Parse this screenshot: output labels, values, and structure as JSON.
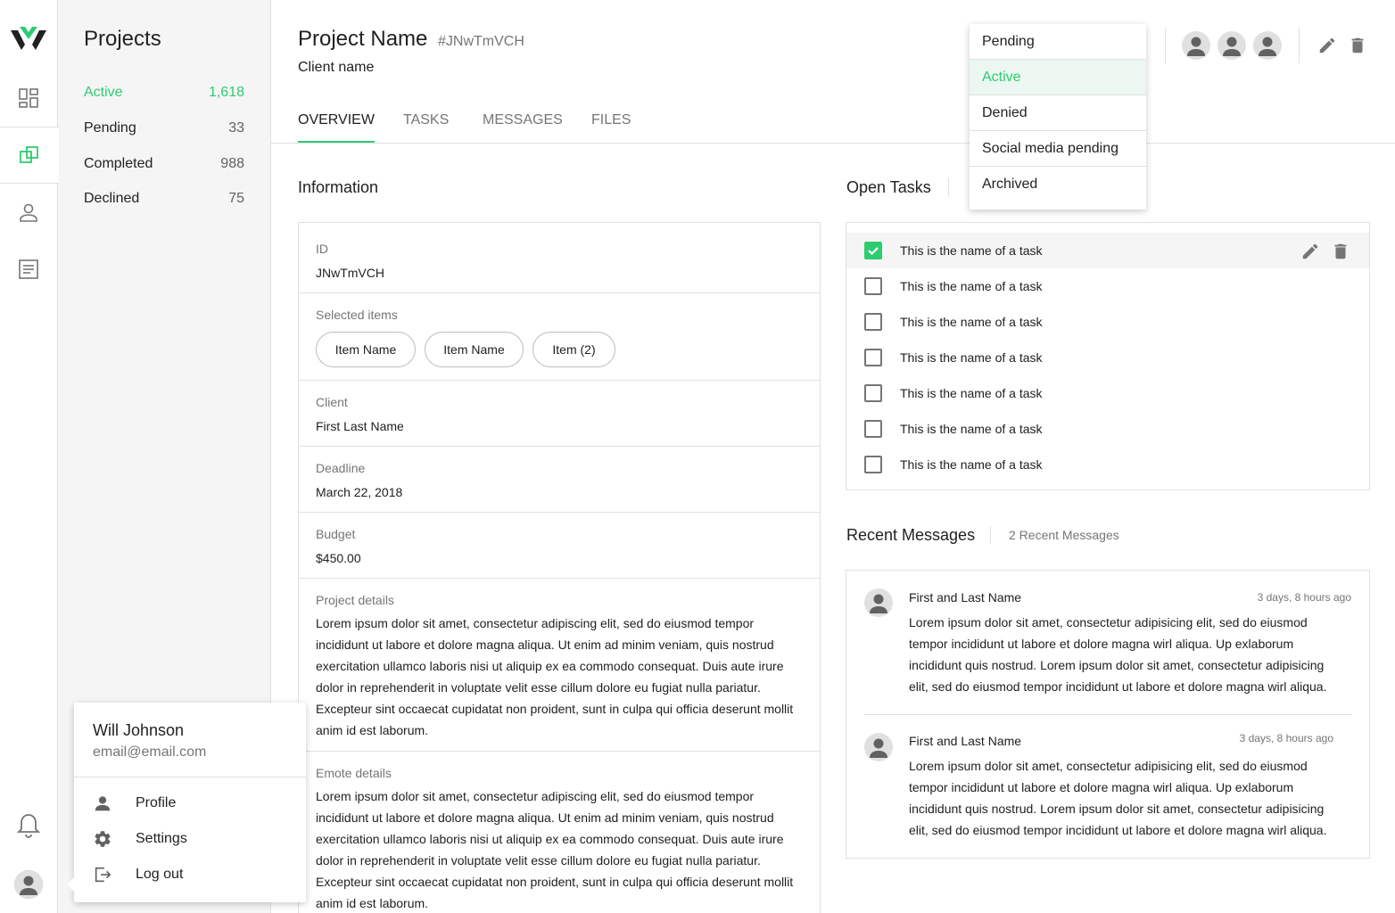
{
  "sidebar": {
    "title": "Projects",
    "filters": [
      {
        "label": "Active",
        "count": "1,618"
      },
      {
        "label": "Pending",
        "count": "33"
      },
      {
        "label": "Completed",
        "count": "988"
      },
      {
        "label": "Declined",
        "count": "75"
      }
    ]
  },
  "user_menu": {
    "name": "Will Johnson",
    "email": "email@email.com",
    "items": [
      {
        "label": "Profile",
        "icon": "person-icon"
      },
      {
        "label": "Settings",
        "icon": "gear-icon"
      },
      {
        "label": "Log out",
        "icon": "logout-icon"
      }
    ]
  },
  "project": {
    "name": "Project Name",
    "id_tag": "#JNwTmVCH",
    "client": "Client name"
  },
  "tabs": [
    "OVERVIEW",
    "TASKS",
    "MESSAGES",
    "FILES"
  ],
  "status_dropdown": {
    "options": [
      "Pending",
      "Active",
      "Denied",
      "Social media pending",
      "Archived"
    ],
    "selected": "Active"
  },
  "information": {
    "title": "Information",
    "id_label": "ID",
    "id_value": "JNwTmVCH",
    "items_label": "Selected items",
    "chips": [
      "Item Name",
      "Item Name",
      "Item (2)"
    ],
    "client_label": "Client",
    "client_value": "First Last Name",
    "deadline_label": "Deadline",
    "deadline_value": "March 22, 2018",
    "budget_label": "Budget",
    "budget_value": "$450.00",
    "project_details_label": "Project details",
    "project_details": "Lorem ipsum dolor sit amet, consectetur adipiscing elit, sed do eiusmod tempor incididunt ut labore et dolore magna aliqua. Ut enim ad minim veniam, quis nostrud exercitation ullamco laboris nisi ut aliquip ex ea commodo consequat. Duis aute irure dolor in reprehenderit in voluptate velit esse cillum dolore eu fugiat nulla pariatur. Excepteur sint occaecat cupidatat non proident, sunt in culpa qui officia deserunt mollit anim id est laborum.",
    "emote_details_label": "Emote details",
    "emote_details": "Lorem ipsum dolor sit amet, consectetur adipiscing elit, sed do eiusmod tempor incididunt ut labore et dolore magna aliqua. Ut enim ad minim veniam, quis nostrud exercitation ullamco laboris nisi ut aliquip ex ea commodo consequat. Duis aute irure dolor in reprehenderit in voluptate velit esse cillum dolore eu fugiat nulla pariatur. Excepteur sint occaecat cupidatat non proident, sunt in culpa qui officia deserunt mollit anim id est laborum."
  },
  "tasks": {
    "title": "Open Tasks",
    "items": [
      {
        "name": "This is the name of a task",
        "checked": true
      },
      {
        "name": "This is the name of a task",
        "checked": false
      },
      {
        "name": "This is the name of a task",
        "checked": false
      },
      {
        "name": "This is the name of a task",
        "checked": false
      },
      {
        "name": "This is the name of a task",
        "checked": false
      },
      {
        "name": "This is the name of a task",
        "checked": false
      },
      {
        "name": "This is the name of a task",
        "checked": false
      }
    ]
  },
  "messages": {
    "title": "Recent Messages",
    "count_label": "2 Recent Messages",
    "items": [
      {
        "sender": "First and Last Name",
        "time": "3 days, 8 hours ago",
        "body": "Lorem ipsum dolor sit amet, consectetur adipisicing elit, sed do eiusmod tempor incididunt ut labore et dolore magna wirl aliqua. Up exlaborum incididunt quis nostrud. Lorem ipsum dolor sit amet, consectetur adipisicing elit, sed do eiusmod tempor incididunt ut labore et dolore magna wirl aliqua."
      },
      {
        "sender": "First and Last Name",
        "time": "3 days, 8 hours ago",
        "body": "Lorem ipsum dolor sit amet, consectetur adipisicing elit, sed do eiusmod tempor incididunt ut labore et dolore magna wirl aliqua. Up exlaborum incididunt quis nostrud. Lorem ipsum dolor sit amet, consectetur adipisicing elit, sed do eiusmod tempor incididunt ut labore et dolore magna wirl aliqua."
      }
    ]
  },
  "colors": {
    "accent": "#2ecc71",
    "sidebar_bg": "#f5f5f5",
    "border": "#e0e0e0",
    "muted_text": "#757575"
  }
}
